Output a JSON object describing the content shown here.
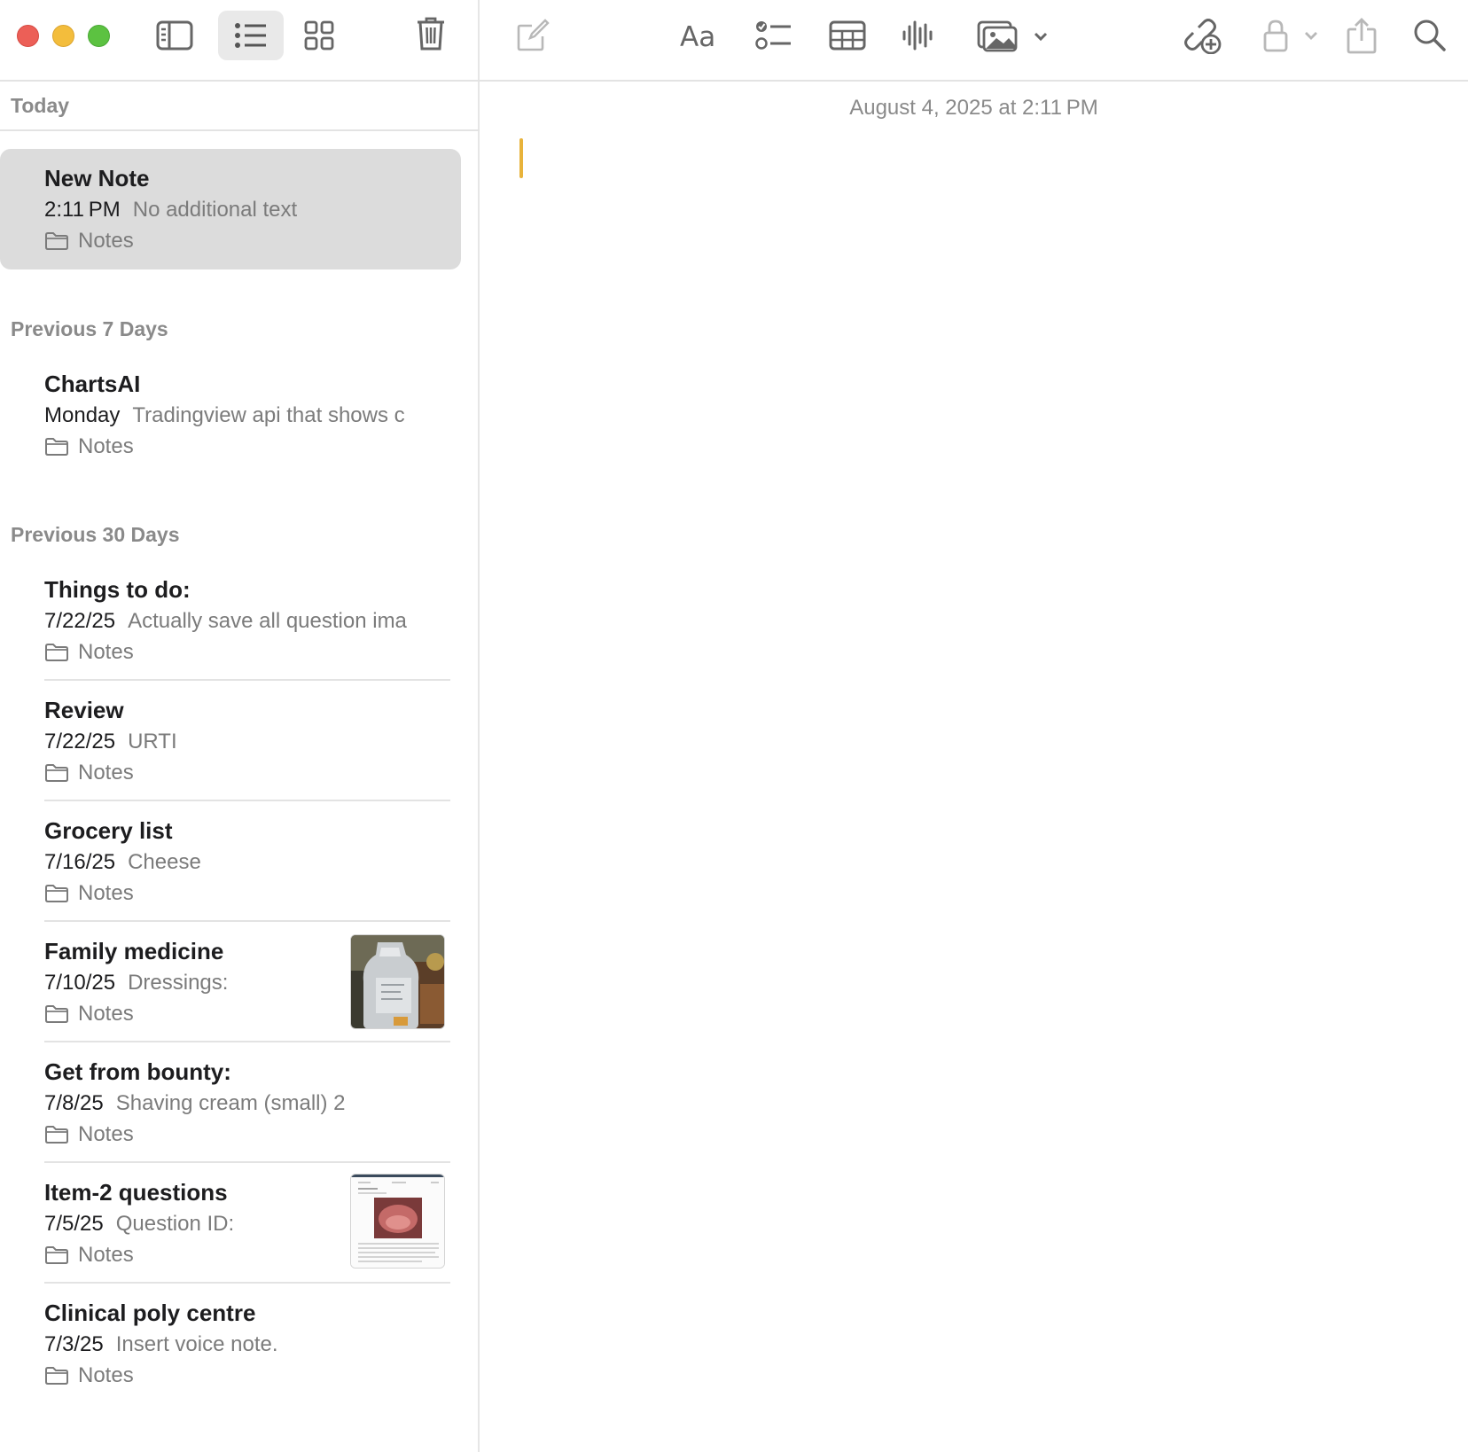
{
  "main": {
    "timestamp": "August 4, 2025 at 2:11 PM",
    "toolbar_icons": [
      "compose-icon",
      "format-icon",
      "checklist-icon",
      "table-icon",
      "audio-icon",
      "media-icon",
      "collaborate-icon",
      "lock-icon",
      "share-icon",
      "search-icon"
    ]
  },
  "colors": {
    "selected_row": "#dcdcdc",
    "caret": "#e8b33b",
    "close": "#ec5f57",
    "minimize": "#f3bd3c",
    "maximize": "#5cc241"
  },
  "sections": {
    "today": "Today",
    "prev7": "Previous 7 Days",
    "prev30": "Previous 30 Days"
  },
  "notes": [
    {
      "title": "New Note",
      "date": "2:11 PM",
      "preview": "No additional text",
      "folder": "Notes"
    },
    {
      "title": "ChartsAI",
      "date": "Monday",
      "preview": "Tradingview api that shows c",
      "folder": "Notes"
    },
    {
      "title": "Things to do:",
      "date": "7/22/25",
      "preview": "Actually save all question ima",
      "folder": "Notes"
    },
    {
      "title": "Review",
      "date": "7/22/25",
      "preview": "URTI",
      "folder": "Notes"
    },
    {
      "title": "Grocery list",
      "date": "7/16/25",
      "preview": "Cheese",
      "folder": "Notes"
    },
    {
      "title": "Family medicine",
      "date": "7/10/25",
      "preview": "Dressings:",
      "folder": "Notes"
    },
    {
      "title": "Get from bounty:",
      "date": "7/8/25",
      "preview": "Shaving cream (small) 2",
      "folder": "Notes"
    },
    {
      "title": "Item-2 questions",
      "date": "7/5/25",
      "preview": "Question ID:",
      "folder": "Notes"
    },
    {
      "title": "Clinical poly centre",
      "date": "7/3/25",
      "preview": "Insert voice note.",
      "folder": "Notes"
    }
  ]
}
